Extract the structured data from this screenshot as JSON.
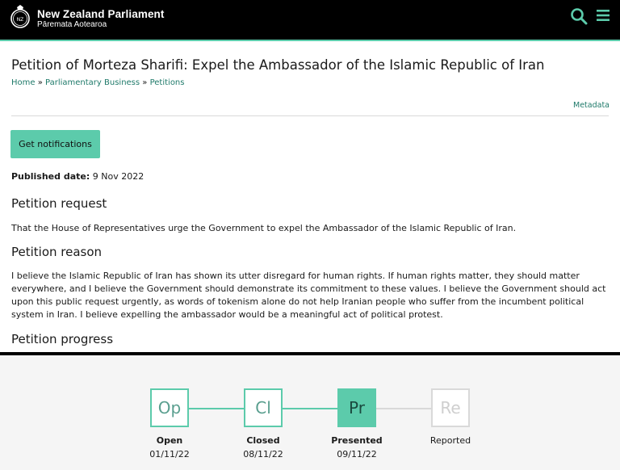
{
  "header": {
    "brand_title": "New Zealand Parliament",
    "brand_subtitle": "Pāremata Aotearoa",
    "accent_color": "#5ccbab"
  },
  "page": {
    "title": "Petition of Morteza Sharifi: Expel the Ambassador of the Islamic Republic of Iran",
    "breadcrumb": {
      "home": "Home",
      "sep": " » ",
      "business": "Parliamentary Business",
      "petitions": "Petitions"
    },
    "metadata_link": "Metadata",
    "notify_button": "Get notifications",
    "published_label": "Published date:",
    "published_value": " 9 Nov 2022"
  },
  "request": {
    "heading": "Petition request",
    "text": "That the House of Representatives urge the Government to expel the Ambassador of the Islamic Republic of Iran."
  },
  "reason": {
    "heading": "Petition reason",
    "text": "I believe the Islamic Republic of Iran has shown its utter disregard for human rights. If human rights matter, they should matter everywhere, and I believe the Government should demonstrate its commitment to these values. I believe the Government should act upon this public request urgently, as words of tokenism alone do not help Iranian people who suffer from the incumbent political system in Iran. I believe expelling the ambassador would be a meaningful act of political protest."
  },
  "progress": {
    "heading": "Petition progress",
    "steps": [
      {
        "abbr": "Op",
        "label": "Open",
        "date": "01/11/22"
      },
      {
        "abbr": "Cl",
        "label": "Closed",
        "date": "08/11/22"
      },
      {
        "abbr": "Pr",
        "label": "Presented",
        "date": "09/11/22"
      },
      {
        "abbr": "Re",
        "label": "Reported",
        "date": ""
      }
    ]
  }
}
